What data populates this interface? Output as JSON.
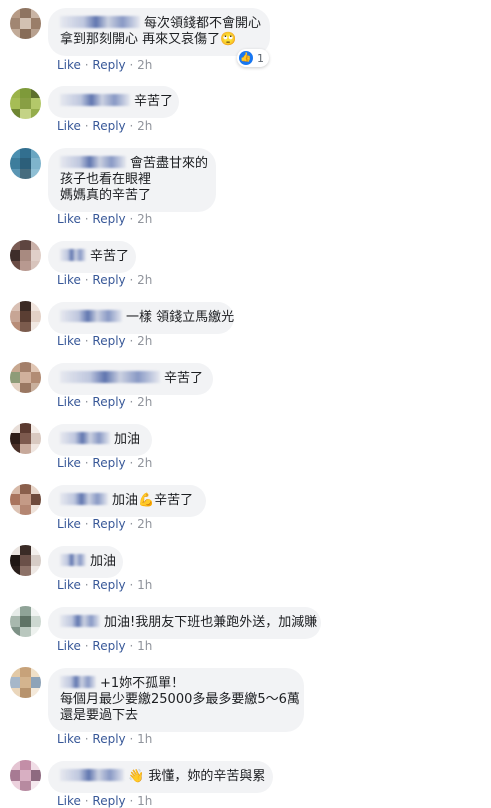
{
  "actions": {
    "like": "Like",
    "reply": "Reply",
    "separator": "·"
  },
  "comments": [
    {
      "lines": [
        "每次領錢都不會開心",
        "拿到那刻開心 再來又哀傷了🙄"
      ],
      "time": "2h",
      "reaction_count": "1"
    },
    {
      "lines": [
        "辛苦了"
      ],
      "time": "2h"
    },
    {
      "lines": [
        "會苦盡甘來的",
        "孩子也看在眼裡",
        "媽媽真的辛苦了"
      ],
      "time": "2h"
    },
    {
      "lines": [
        "辛苦了"
      ],
      "time": "2h"
    },
    {
      "lines": [
        "一樣 領錢立馬繳光"
      ],
      "time": "2h"
    },
    {
      "lines": [
        "辛苦了"
      ],
      "time": "2h"
    },
    {
      "lines": [
        "加油"
      ],
      "time": "2h"
    },
    {
      "lines": [
        "加油💪辛苦了"
      ],
      "time": "2h"
    },
    {
      "lines": [
        "加油"
      ],
      "time": "1h"
    },
    {
      "lines": [
        "加油!我朋友下班也兼跑外送，加減賺"
      ],
      "time": "1h"
    },
    {
      "lines": [
        "+1妳不孤單！",
        "每個月最少要繳25000多最多要繳5～6萬",
        "還是要過下去"
      ],
      "time": "1h"
    },
    {
      "lines": [
        "👋 我懂，妳的辛苦與累"
      ],
      "time": "1h"
    }
  ]
}
